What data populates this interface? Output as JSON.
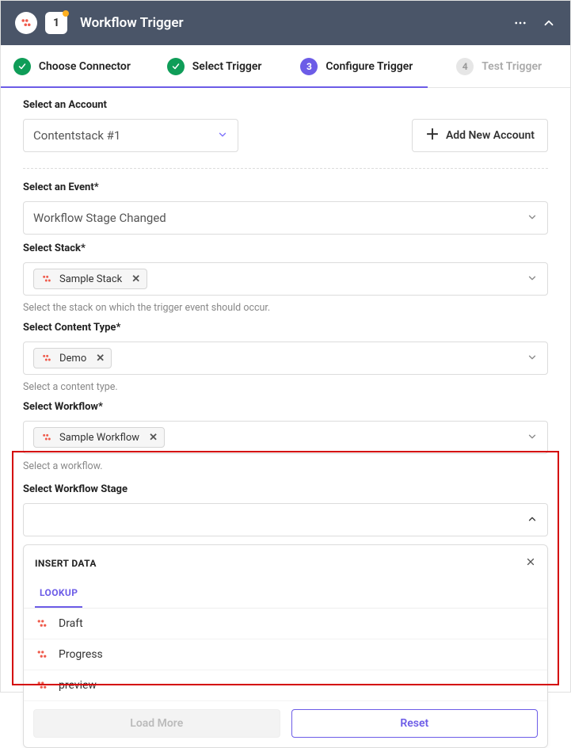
{
  "header": {
    "step_number": "1",
    "title": "Workflow Trigger"
  },
  "steps": [
    {
      "label": "Choose Connector",
      "state": "done"
    },
    {
      "label": "Select Trigger",
      "state": "done"
    },
    {
      "label": "Configure Trigger",
      "state": "active",
      "num": "3"
    },
    {
      "label": "Test Trigger",
      "state": "pending",
      "num": "4"
    }
  ],
  "account": {
    "label": "Select an Account",
    "value": "Contentstack #1",
    "add_button": "Add New Account"
  },
  "event": {
    "label": "Select an Event*",
    "value": "Workflow Stage Changed"
  },
  "stack": {
    "label": "Select Stack*",
    "chip": "Sample Stack",
    "help": "Select the stack on which the trigger event should occur."
  },
  "content_type": {
    "label": "Select Content Type*",
    "chip": "Demo",
    "help": "Select a content type."
  },
  "workflow": {
    "label": "Select Workflow*",
    "chip": "Sample Workflow",
    "help": "Select a workflow."
  },
  "stage": {
    "label": "Select Workflow Stage",
    "insert_label": "INSERT DATA",
    "tab_lookup": "LOOKUP",
    "options": [
      "Draft",
      "Progress",
      "preview"
    ],
    "load_more": "Load More",
    "reset": "Reset"
  }
}
